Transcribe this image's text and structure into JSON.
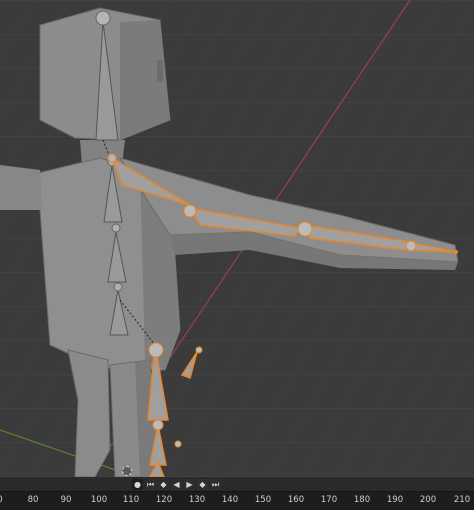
{
  "viewport": {
    "background_color": "#3b3b3b",
    "grid_color": "#4a4a4a",
    "mesh_color": "#8e8e8e",
    "bone_color": "#9a9a9a",
    "selected_bone_outline": "#e8862a",
    "x_axis_color": "#c14050",
    "y_axis_color": "#6a9a30"
  },
  "playback": {
    "buttons": [
      {
        "icon": "keyframe-dot-icon",
        "glyph": "●"
      },
      {
        "icon": "jump-to-start-icon",
        "glyph": "⏮"
      },
      {
        "icon": "prev-keyframe-icon",
        "glyph": "◆"
      },
      {
        "icon": "play-reverse-icon",
        "glyph": "◀"
      },
      {
        "icon": "play-icon",
        "glyph": "▶"
      },
      {
        "icon": "next-keyframe-icon",
        "glyph": "◆"
      },
      {
        "icon": "jump-to-end-icon",
        "glyph": "⏭"
      }
    ]
  },
  "timeline": {
    "ticks": [
      "0",
      "80",
      "90",
      "100",
      "110",
      "120",
      "130",
      "140",
      "150",
      "160",
      "170",
      "180",
      "190",
      "200",
      "210"
    ]
  }
}
